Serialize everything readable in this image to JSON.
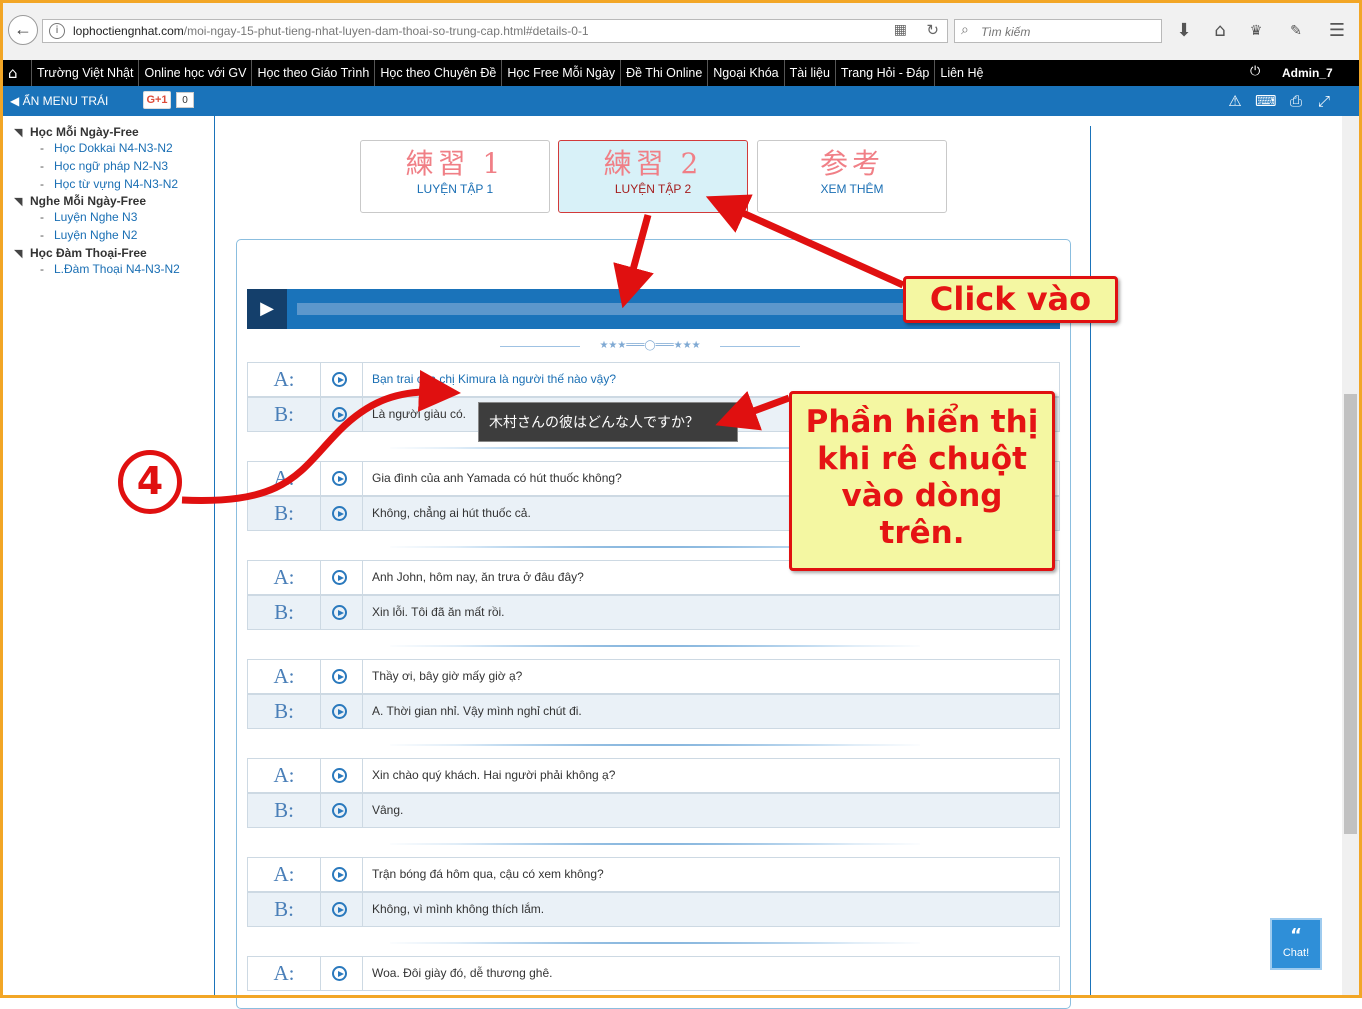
{
  "browser": {
    "url_domain": "lophoctiengnhat.com",
    "url_path": "/moi-ngay-15-phut-tieng-nhat-luyen-dam-thoai-so-trung-cap.html#details-0-1",
    "search_placeholder": "Tìm kiếm"
  },
  "nav": {
    "items": [
      "Trường Việt Nhật",
      "Online học với GV",
      "Học theo Giáo Trình",
      "Học theo Chuyên Đề",
      "Học Free Mỗi Ngày",
      "Đề Thi Online",
      "Ngoại Khóa",
      "Tài liệu",
      "Trang Hỏi - Đáp",
      "Liên Hệ"
    ],
    "user": "Admin_7"
  },
  "bluebar": {
    "hide_menu": "ẨN MENU TRÁI",
    "gplus": "G+1",
    "gplus_count": "0"
  },
  "sidebar": {
    "groups": [
      {
        "title": "Học Mỗi Ngày-Free",
        "items": [
          "Học Dokkai N4-N3-N2",
          "Học ngữ pháp N2-N3",
          "Học từ vựng N4-N3-N2"
        ]
      },
      {
        "title": "Nghe Mỗi Ngày-Free",
        "items": [
          "Luyện Nghe N3",
          "Luyện Nghe N2"
        ]
      },
      {
        "title": "Học Đàm Thoại-Free",
        "items": [
          "L.Đàm Thoại N4-N3-N2"
        ]
      }
    ]
  },
  "tabs": [
    {
      "kanji": "練習 1",
      "label": "LUYỆN TẬP 1",
      "active": false
    },
    {
      "kanji": "練習 2",
      "label": "LUYỆN TẬP 2",
      "active": true
    },
    {
      "kanji": "参考",
      "label": "XEM THÊM",
      "active": false
    }
  ],
  "ornament": "★★★═══◯═══★★★",
  "dialogs": [
    {
      "a": "Bạn trai của chị Kimura là người thế nào vậy?",
      "b": "Là người giàu có."
    },
    {
      "a": "Gia đình của anh Yamada có hút thuốc không?",
      "b": "Không, chẳng ai hút thuốc cả."
    },
    {
      "a": "Anh John, hôm nay, ăn trưa ở đâu đây?",
      "b": "Xin lỗi. Tôi đã ăn mất rồi."
    },
    {
      "a": "Thầy ơi, bây giờ mấy giờ ạ?",
      "b": "A. Thời gian nhỉ. Vậy mình nghỉ chút đi."
    },
    {
      "a": "Xin chào quý khách. Hai người phải không ạ?",
      "b": "Vâng."
    },
    {
      "a": "Trận bóng đá hôm qua, cậu có xem không?",
      "b": "Không, vì mình không thích lắm."
    },
    {
      "a": "Woa. Đôi giày đó, dễ thương ghê.",
      "b": ""
    }
  ],
  "speaker_a": "A:",
  "speaker_b": "B:",
  "tooltip": "木村さんの彼はどんな人ですか？",
  "annotations": {
    "click_label": "Click vào",
    "hover_lines": [
      "Phần hiển thị",
      "khi rê chuột",
      "vào dòng",
      "trên."
    ],
    "step_number": "4"
  },
  "chat_widget": "Chat!",
  "colors": {
    "accent": "#1a73ba",
    "annotation_red": "#e01010",
    "callout_bg": "#f4f7a2",
    "kanji_pink": "#f07f86"
  }
}
